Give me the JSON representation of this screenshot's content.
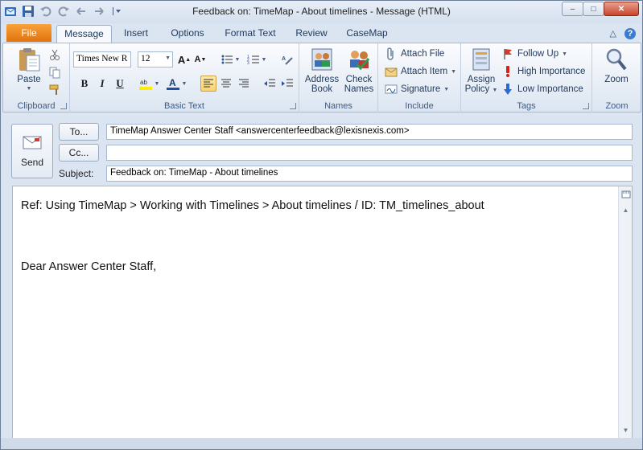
{
  "window": {
    "title": "Feedback on: TimeMap - About timelines  -  Message (HTML)",
    "controls": {
      "minimize": "–",
      "maximize": "□",
      "close": "✕"
    }
  },
  "tabs": {
    "file": "File",
    "items": [
      "Message",
      "Insert",
      "Options",
      "Format Text",
      "Review",
      "CaseMap"
    ],
    "help_icons": [
      "△",
      "?"
    ]
  },
  "ribbon": {
    "clipboard": {
      "label": "Clipboard",
      "paste": "Paste"
    },
    "basic_text": {
      "label": "Basic Text",
      "font_name": "Times New R",
      "font_size": "12"
    },
    "names": {
      "label": "Names",
      "address_book_line1": "Address",
      "address_book_line2": "Book",
      "check_names_line1": "Check",
      "check_names_line2": "Names"
    },
    "include": {
      "label": "Include",
      "attach_file": "Attach File",
      "attach_item": "Attach Item",
      "signature": "Signature"
    },
    "tags": {
      "label": "Tags",
      "assign_policy_line1": "Assign",
      "assign_policy_line2": "Policy",
      "follow_up": "Follow Up",
      "high_importance": "High Importance",
      "low_importance": "Low Importance"
    },
    "zoom": {
      "label": "Zoom",
      "zoom": "Zoom"
    }
  },
  "compose": {
    "send": "Send",
    "to_button": "To...",
    "cc_button": "Cc...",
    "subject_label": "Subject:",
    "to_value": "TimeMap Answer Center Staff <answercenterfeedback@lexisnexis.com>",
    "cc_value": "",
    "subject_value": "Feedback on: TimeMap - About timelines"
  },
  "body": {
    "ref_line": "Ref: Using TimeMap > Working with Timelines > About timelines / ID: TM_timelines_about",
    "greeting": "Dear Answer Center Staff,"
  }
}
